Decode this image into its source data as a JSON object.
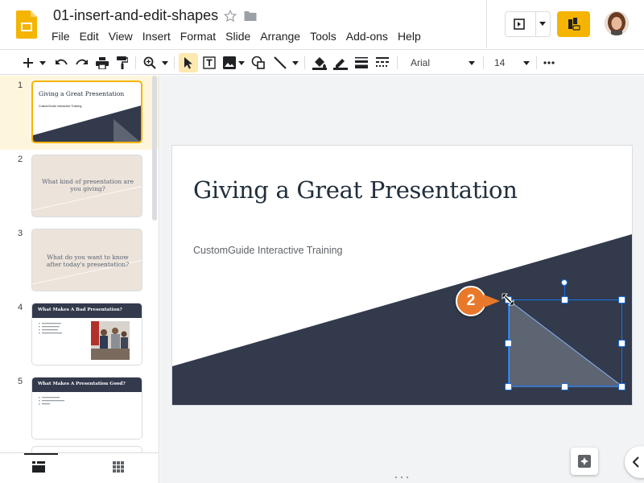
{
  "header": {
    "doc_title": "01-insert-and-edit-shapes",
    "menu": [
      "File",
      "Edit",
      "View",
      "Insert",
      "Format",
      "Slide",
      "Arrange",
      "Tools",
      "Add-ons",
      "Help"
    ]
  },
  "toolbar": {
    "font_family": "Arial",
    "font_size": "14"
  },
  "slides": [
    {
      "number": "1",
      "title": "Giving a Great Presentation",
      "subtitle": "CustomGuide Interactive Training",
      "selected": true
    },
    {
      "number": "2",
      "title": "What kind of presentation are you giving?"
    },
    {
      "number": "3",
      "title": "What do you want to know after today's presentation?"
    },
    {
      "number": "4",
      "title": "What Makes A Bad Presentation?"
    },
    {
      "number": "5",
      "title": "What Makes A Presentation Good?"
    }
  ],
  "canvas": {
    "title": "Giving a Great Presentation",
    "subtitle": "CustomGuide Interactive Training"
  },
  "callout": {
    "label": "2"
  },
  "colors": {
    "slides_brand": "#f4b400",
    "slide_dark": "#323a4c",
    "shape_fill": "#5d6472",
    "selection": "#1a73e8",
    "callout": "#e8792b"
  }
}
